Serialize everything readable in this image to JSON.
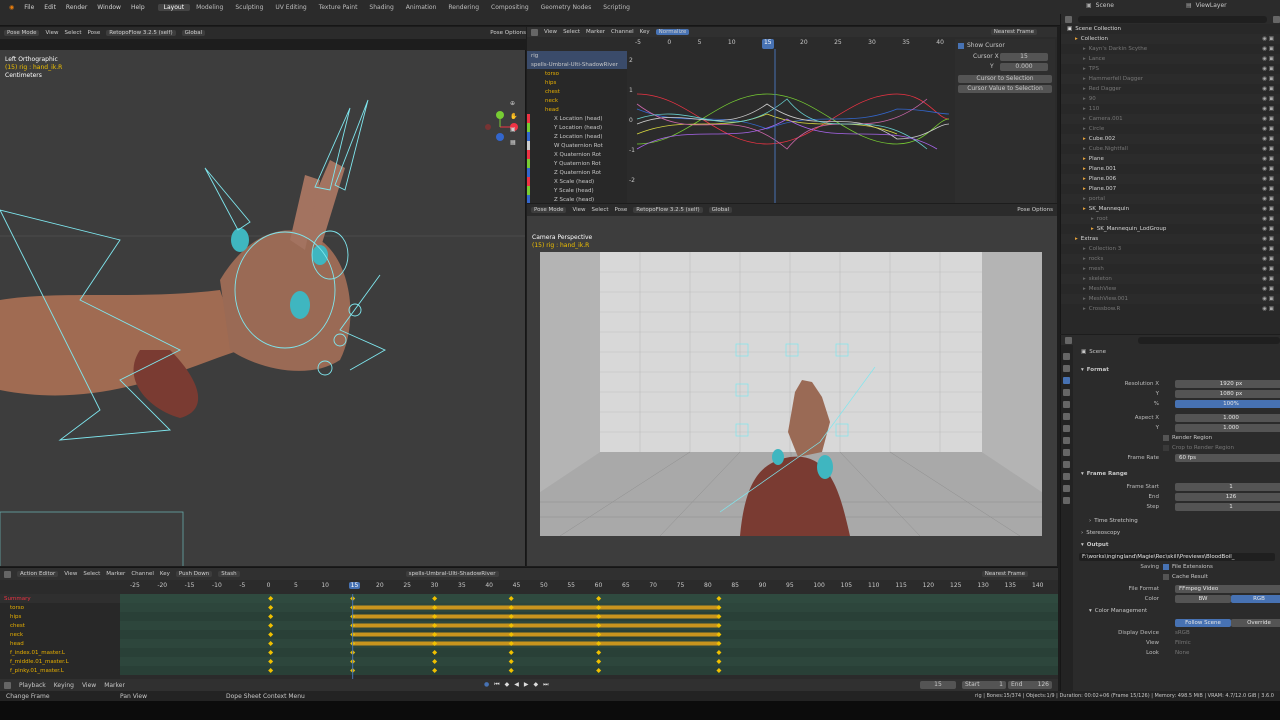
{
  "menu": {
    "items": [
      "File",
      "Edit",
      "Render",
      "Window",
      "Help"
    ],
    "workspaces": [
      "Layout",
      "Modeling",
      "Sculpting",
      "UV Editing",
      "Texture Paint",
      "Shading",
      "Animation",
      "Rendering",
      "Compositing",
      "Geometry Nodes",
      "Scripting"
    ],
    "active_workspace": "Layout",
    "scene_label": "Scene",
    "viewlayer_label": "ViewLayer"
  },
  "viewport3d": {
    "mode": "Pose Mode",
    "menu": [
      "View",
      "Select",
      "Pose"
    ],
    "rig_name": "RetopoFlow 3.2.5 (self)",
    "orientation": "Global",
    "pose_options": "Pose Options",
    "view_name": "Left Orthographic",
    "bone_info": "(15) rig : hand_ik.R",
    "units": "Centimeters"
  },
  "graph": {
    "menu": [
      "View",
      "Select",
      "Marker",
      "Channel",
      "Key"
    ],
    "normalize": "Normalize",
    "interp": "Nearest Frame",
    "ruler": [
      "-5",
      "0",
      "5",
      "10",
      "15",
      "20",
      "25",
      "30",
      "35",
      "40"
    ],
    "current_frame": "15",
    "yvals": [
      "2",
      "1",
      "0",
      "-1",
      "-2"
    ],
    "channels": [
      "rig",
      "spells-Umbral-Ulti-ShadowRiver",
      "torso",
      "hips",
      "chest",
      "neck",
      "head",
      "X Location (head)",
      "Y Location (head)",
      "Z Location (head)",
      "W Quaternion Rot",
      "X Quaternion Rot",
      "Y Quaternion Rot",
      "Z Quaternion Rot",
      "X Scale (head)",
      "Y Scale (head)",
      "Z Scale (head)"
    ],
    "show_cursor": "Show Cursor",
    "cursor_x_label": "Cursor X",
    "cursor_x": "15",
    "cursor_y_label": "Y",
    "cursor_y": "0.000",
    "cursor_to_sel": "Cursor to Selection",
    "cursor_val_sel": "Cursor Value to Selection"
  },
  "camview": {
    "mode": "Pose Mode",
    "menu": [
      "View",
      "Select",
      "Pose"
    ],
    "rig_name": "RetopoFlow 3.2.5 (self)",
    "orientation": "Global",
    "pose_options": "Pose Options",
    "view_name": "Camera Perspective",
    "bone_info": "(15) rig : hand_ik.R"
  },
  "outliner": {
    "title": "Scene Collection",
    "items": [
      {
        "label": "Collection",
        "depth": 1
      },
      {
        "label": "Kayn's Darkin Scythe",
        "depth": 2,
        "dim": true
      },
      {
        "label": "Lance",
        "depth": 2,
        "dim": true
      },
      {
        "label": "TPS",
        "depth": 2,
        "dim": true
      },
      {
        "label": "Hammerfell Dagger",
        "depth": 2,
        "dim": true
      },
      {
        "label": "Red Dagger",
        "depth": 2,
        "dim": true
      },
      {
        "label": "90",
        "depth": 2,
        "dim": true
      },
      {
        "label": "110",
        "depth": 2,
        "dim": true
      },
      {
        "label": "Camera.001",
        "depth": 2,
        "dim": true
      },
      {
        "label": "Circle",
        "depth": 2,
        "dim": true
      },
      {
        "label": "Cube.002",
        "depth": 2
      },
      {
        "label": "Cube.Nightfall",
        "depth": 2,
        "dim": true
      },
      {
        "label": "Plane",
        "depth": 2
      },
      {
        "label": "Plane.001",
        "depth": 2
      },
      {
        "label": "Plane.006",
        "depth": 2
      },
      {
        "label": "Plane.007",
        "depth": 2
      },
      {
        "label": "portal",
        "depth": 2,
        "dim": true
      },
      {
        "label": "SK_Mannequin",
        "depth": 2
      },
      {
        "label": "root",
        "depth": 3,
        "dim": true
      },
      {
        "label": "SK_Mannequin_LodGroup",
        "depth": 3
      },
      {
        "label": "Extras",
        "depth": 1
      },
      {
        "label": "Collection 3",
        "depth": 2,
        "dim": true
      },
      {
        "label": "rocks",
        "depth": 2,
        "dim": true
      },
      {
        "label": "mesh",
        "depth": 2,
        "dim": true
      },
      {
        "label": "skeleton",
        "depth": 2,
        "dim": true
      },
      {
        "label": "MeshView",
        "depth": 2,
        "dim": true
      },
      {
        "label": "MeshView.001",
        "depth": 2,
        "dim": true
      },
      {
        "label": "Crossbow.R",
        "depth": 2,
        "dim": true
      }
    ]
  },
  "props": {
    "context": "Scene",
    "format_title": "Format",
    "res_x_label": "Resolution X",
    "res_x": "1920 px",
    "res_y_label": "Y",
    "res_y": "1080 px",
    "res_pct_label": "%",
    "res_pct": "100%",
    "aspect_x_label": "Aspect X",
    "aspect_x": "1.000",
    "aspect_y_label": "Y",
    "aspect_y": "1.000",
    "render_region": "Render Region",
    "crop_region": "Crop to Render Region",
    "frame_rate_label": "Frame Rate",
    "frame_rate": "60 fps",
    "frame_range_title": "Frame Range",
    "frame_start_label": "Frame Start",
    "frame_start": "1",
    "end_label": "End",
    "end": "126",
    "step_label": "Step",
    "step": "1",
    "time_stretching": "Time Stretching",
    "stereoscopy": "Stereoscopy",
    "output_title": "Output",
    "output_path": "F:\\works\\ingingland\\Magie\\Rec\\skill\\Previews\\BloodBoil_",
    "saving_label": "Saving",
    "file_ext": "File Extensions",
    "cache_result": "Cache Result",
    "file_format_label": "File Format",
    "file_format": "FFmpeg Video",
    "color_label": "Color",
    "color_bw": "BW",
    "color_rgb": "RGB",
    "color_mgmt": "Color Management",
    "follow_scene": "Follow Scene",
    "override": "Override",
    "display_device_label": "Display Device",
    "display_device": "sRGB",
    "view_label": "View",
    "view_value": "Filmic",
    "look_label": "Look",
    "look_value": "None"
  },
  "action": {
    "mode": "Action Editor",
    "menu": [
      "View",
      "Select",
      "Marker",
      "Channel",
      "Key"
    ],
    "push_down": "Push Down",
    "stash": "Stash",
    "action_name": "spells-Umbral-Ulti-ShadowRiver",
    "interp": "Nearest Frame",
    "ruler": [
      "-25",
      "-20",
      "-15",
      "-10",
      "-5",
      "0",
      "5",
      "10",
      "15",
      "20",
      "25",
      "30",
      "35",
      "40",
      "45",
      "50",
      "55",
      "60",
      "65",
      "70",
      "75",
      "80",
      "85",
      "90",
      "95",
      "100",
      "105",
      "110",
      "115",
      "120",
      "125",
      "130",
      "135",
      "140"
    ],
    "current_frame": "15",
    "channels": [
      "Summary",
      "torso",
      "hips",
      "chest",
      "neck",
      "head",
      "f_index.01_master.L",
      "f_middle.01_master.L",
      "f_pinky.01_master.L"
    ]
  },
  "timeline": {
    "menu": [
      "Playback",
      "Keying",
      "View",
      "Marker"
    ],
    "current": "15",
    "start_label": "Start",
    "start": "1",
    "end_label": "End",
    "end": "126"
  },
  "status": {
    "left1": "Change Frame",
    "left2": "Pan View",
    "left3": "Dope Sheet Context Menu",
    "right": "rig | Bones:15/374 | Objects:1/9 | Duration: 00:02+06 (Frame 15/126) | Memory: 498.5 MiB | VRAM: 4.7/12.0 GiB | 3.6.0"
  },
  "colors": {
    "accent": "#4772b3",
    "keyframe": "#f0c000",
    "action_bar": "#c8941e",
    "playhead": "#4772b3"
  }
}
